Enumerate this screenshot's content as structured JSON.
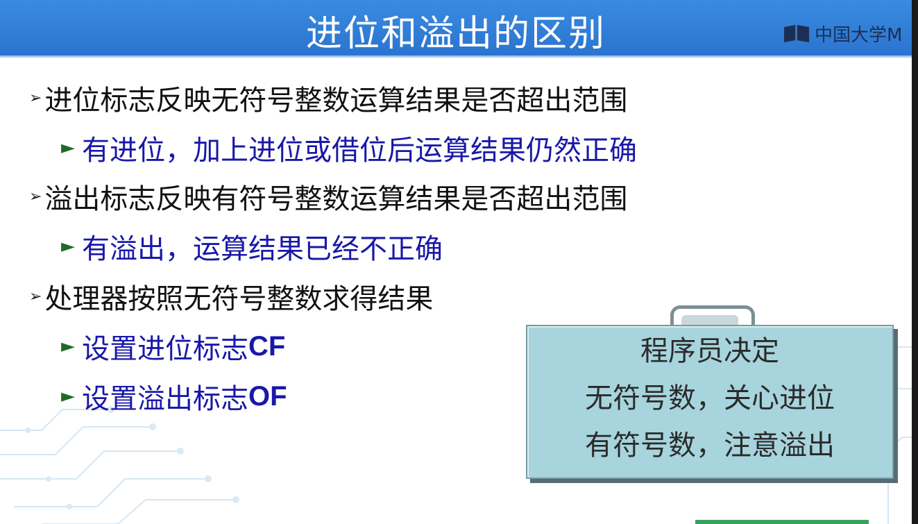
{
  "slide": {
    "title": "进位和溢出的区别",
    "logo_text": "中国大学M"
  },
  "bullets": [
    {
      "level": 1,
      "text": "进位标志反映无符号整数运算结果是否超出范围"
    },
    {
      "level": 2,
      "text": "有进位，加上进位或借位后运算结果仍然正确"
    },
    {
      "level": 1,
      "text": "溢出标志反映有符号整数运算结果是否超出范围"
    },
    {
      "level": 2,
      "text": "有溢出，运算结果已经不正确"
    },
    {
      "level": 1,
      "text": "处理器按照无符号整数求得结果"
    },
    {
      "level": 2,
      "text": "设置进位标志",
      "strong": "CF"
    },
    {
      "level": 2,
      "text": "设置溢出标志",
      "strong": "OF"
    }
  ],
  "note": {
    "lines": [
      "程序员决定",
      "无符号数，关心进位",
      "有符号数，注意溢出"
    ]
  },
  "markers": {
    "level1": "➢",
    "level2": "►"
  },
  "colors": {
    "title_bar": "#2a74cf",
    "level1_text": "#111111",
    "level2_text": "#1818a8",
    "level2_marker": "#1f6b2a",
    "note_fill": "#a7d4dd"
  },
  "icons": {
    "logo": "mooc-logo-icon"
  }
}
